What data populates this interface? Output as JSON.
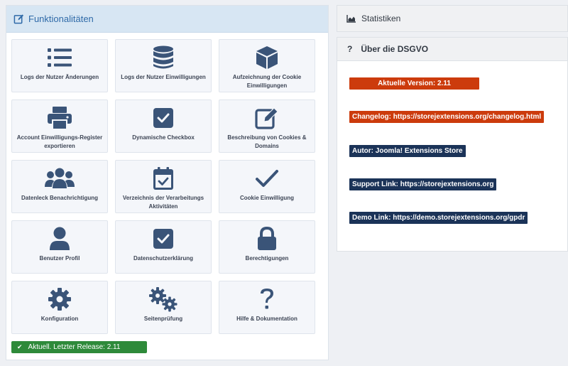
{
  "left_panel": {
    "title": "Funktionalitäten",
    "tiles": [
      {
        "label": "Logs der Nutzer Änderungen",
        "icon": "list-icon"
      },
      {
        "label": "Logs der Nutzer Einwilligungen",
        "icon": "database-icon"
      },
      {
        "label": "Aufzeichnung der Cookie Einwilligungen",
        "icon": "cube-icon"
      },
      {
        "label": "Account Einwilligungs-Register exportieren",
        "icon": "printer-icon"
      },
      {
        "label": "Dynamische Checkbox",
        "icon": "checkbox-icon"
      },
      {
        "label": "Beschreibung von Cookies & Domains",
        "icon": "edit-icon"
      },
      {
        "label": "Datenleck Benachrichtigung",
        "icon": "users-icon"
      },
      {
        "label": "Verzeichnis der Verarbeitungs Aktivitäten",
        "icon": "calendar-check-icon"
      },
      {
        "label": "Cookie Einwilligung",
        "icon": "checkmark-icon"
      },
      {
        "label": "Benutzer Profil",
        "icon": "user-icon"
      },
      {
        "label": "Datenschutzerklärung",
        "icon": "checkbox-icon"
      },
      {
        "label": "Berechtigungen",
        "icon": "lock-icon"
      },
      {
        "label": "Konfiguration",
        "icon": "gear-icon"
      },
      {
        "label": "Seitenprüfung",
        "icon": "gears-icon"
      },
      {
        "label": "Hilfe & Dokumentation",
        "icon": "question-icon"
      }
    ],
    "release_badge": "Aktuell. Letzter Release: 2.11"
  },
  "stats": {
    "title": "Statistiken",
    "icon": "area-chart-icon"
  },
  "dsgvo": {
    "title": "Über die DSGVO",
    "question_mark": "?",
    "version": "Aktuelle Version: 2.11",
    "changelog": "Changelog: https://storejextensions.org/changelog.html",
    "author": "Autor: Joomla! Extensions Store",
    "support": "Support Link: https://storejextensions.org",
    "demo": "Demo Link: https://demo.storejextensions.org/gpdr"
  },
  "colors": {
    "icon": "#3a5478",
    "accent_blue": "#2f6aa8",
    "header_bg": "#d7e6f3",
    "success": "#2e8a3a",
    "orange": "#cc3b0c",
    "navy": "#1b3358"
  }
}
